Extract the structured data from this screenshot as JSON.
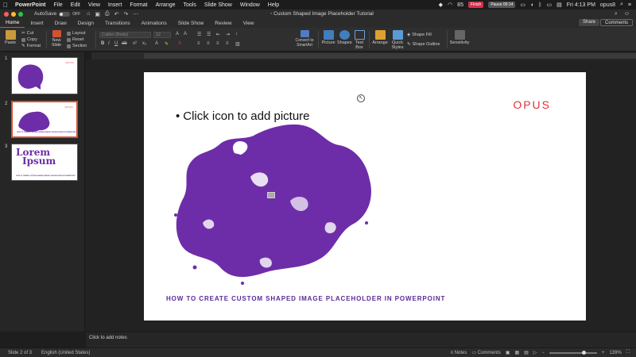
{
  "menubar": {
    "app": "PowerPoint",
    "items": [
      "File",
      "Edit",
      "View",
      "Insert",
      "Format",
      "Arrange",
      "Tools",
      "Slide Show",
      "Window",
      "Help"
    ],
    "clock": "Fri 4:13 PM",
    "user": "opus8",
    "status_pill_1": "Finish",
    "status_pill_2": "Pause 00:14",
    "percent": "85"
  },
  "titlebar": {
    "autosave_label": "AutoSave",
    "autosave_state": "OFF",
    "doc_title": "Custom Shaped Image Placeholder Tutorial"
  },
  "ribbon_tabs": {
    "tabs": [
      "Home",
      "Insert",
      "Draw",
      "Design",
      "Transitions",
      "Animations",
      "Slide Show",
      "Review",
      "View"
    ],
    "active": "Home",
    "share": "Share",
    "comments": "Comments"
  },
  "ribbon": {
    "paste": "Paste",
    "cut": "Cut",
    "copy": "Copy",
    "format": "Format",
    "new_slide": "New Slide",
    "layout": "Layout",
    "reset": "Reset",
    "section": "Section",
    "font_name": "Calibri (Body)",
    "font_size": "12",
    "convert_smartart": "Convert to SmartArt",
    "picture": "Picture",
    "shapes": "Shapes",
    "text_box": "Text Box",
    "arrange": "Arrange",
    "quick_styles": "Quick Styles",
    "shape_fill": "Shape Fill",
    "shape_outline": "Shape Outline",
    "sensitivity": "Sensitivity"
  },
  "thumbnails": [
    {
      "num": "1"
    },
    {
      "num": "2"
    },
    {
      "num": "3",
      "title_line1": "Lorem",
      "title_line2": "Ipsum"
    }
  ],
  "slide": {
    "bullet": "•",
    "placeholder_text": "Click icon to add picture",
    "logo": "OPUS",
    "caption": "HOW TO CREATE CUSTOM SHAPED IMAGE PLACEHOLDER IN POWERPOINT"
  },
  "notes": {
    "placeholder": "Click to add notes"
  },
  "statusbar": {
    "slide_indicator": "Slide 2 of 3",
    "language": "English (United States)",
    "notes": "Notes",
    "comments": "Comments",
    "zoom": "139%",
    "zoom_fraction": 0.68
  },
  "colors": {
    "accent": "#d35230",
    "purple": "#6e2da8",
    "logo_red": "#e0303a"
  }
}
